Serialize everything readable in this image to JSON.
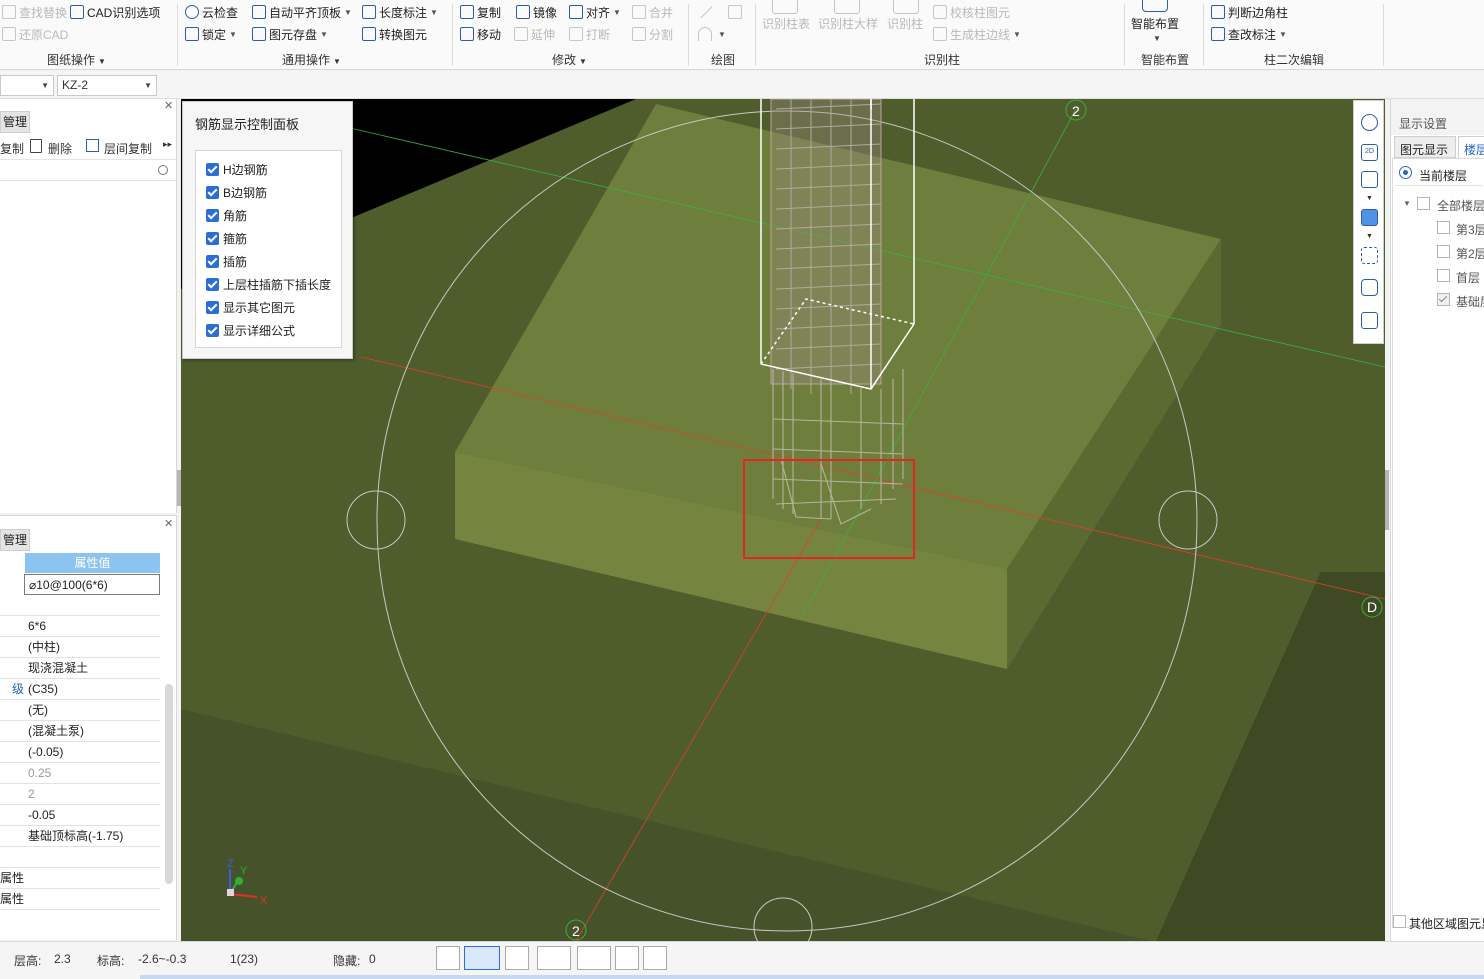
{
  "ribbon": {
    "groups": {
      "drawing_ops": "图纸操作",
      "common_ops": "通用操作",
      "modify": "修改",
      "draw": "绘图",
      "identify_column": "识别柱",
      "smart_layout": "智能布置",
      "column_secondary_edit": "柱二次编辑"
    },
    "items": {
      "find_replace": "查找替换",
      "cad_options": "CAD识别选项",
      "restore_cad": "还原CAD",
      "cloud_check": "云检查",
      "auto_flush_top": "自动平齐顶板",
      "length_dim": "长度标注",
      "lock": "锁定",
      "element_save": "图元存盘",
      "convert_element": "转换图元",
      "copy": "复制",
      "mirror": "镜像",
      "align": "对齐",
      "merge": "合并",
      "move": "移动",
      "extend": "延伸",
      "break": "打断",
      "split": "分割",
      "identify_column_table": "识别柱表",
      "identify_column_detail": "识别柱大样",
      "identify_column": "识别柱",
      "check_column": "校核柱图元",
      "gen_column_edge": "生成柱边线",
      "smart_layout": "智能布置",
      "judge_corner_column": "判断边角柱",
      "check_annotation": "查改标注"
    }
  },
  "sub_toolbar": {
    "combo_left_value": "",
    "combo_component_value": "KZ-2"
  },
  "left_top_panel": {
    "tab_label": "管理",
    "copy_label": "复制",
    "delete_label": "删除",
    "floor_copy_label": "层间复制"
  },
  "left_bottom_panel": {
    "tab_label": "管理",
    "header_value": "属性值",
    "rows": [
      {
        "key": "",
        "value": "⌀10@100(6*6)"
      },
      {
        "key": "",
        "value": ""
      },
      {
        "key": "",
        "value": "6*6"
      },
      {
        "key": "",
        "value": "(中柱)"
      },
      {
        "key": "",
        "value": "现浇混凝土"
      },
      {
        "key": "级",
        "value": "(C35)"
      },
      {
        "key": "",
        "value": "(无)"
      },
      {
        "key": "",
        "value": "(混凝土泵)"
      },
      {
        "key": "",
        "value": "(-0.05)"
      },
      {
        "key": "",
        "value": "0.25"
      },
      {
        "key": "",
        "value": "2"
      },
      {
        "key": "",
        "value": "-0.05"
      },
      {
        "key": "",
        "value": "基础顶标高(-1.75)"
      },
      {
        "key": "",
        "value": ""
      },
      {
        "key": "属性",
        "value": ""
      },
      {
        "key": "属性",
        "value": ""
      }
    ]
  },
  "rebar_panel": {
    "title": "钢筋显示控制面板",
    "options": [
      {
        "label": "H边钢筋",
        "checked": true
      },
      {
        "label": "B边钢筋",
        "checked": true
      },
      {
        "label": "角筋",
        "checked": true
      },
      {
        "label": "箍筋",
        "checked": true
      },
      {
        "label": "插筋",
        "checked": true
      },
      {
        "label": "上层柱插筋下插长度",
        "checked": true
      },
      {
        "label": "显示其它图元",
        "checked": true
      },
      {
        "label": "显示详细公式",
        "checked": true
      }
    ]
  },
  "viewport": {
    "axis_label_2_top": "2",
    "axis_label_2_bottom": "2",
    "axis_label_d": "D",
    "coord_x": "X",
    "coord_y": "Y",
    "coord_z": "Z",
    "colors": {
      "background": "#000000",
      "slab": "#6e7e3c",
      "grid_green": "#3cb043",
      "grid_red": "#e0402a",
      "highlight": "#e52520"
    }
  },
  "right_panel": {
    "title": "显示设置",
    "tab_element": "图元显示",
    "tab_floor": "楼层",
    "current_floor": "当前楼层",
    "all_floors": "全部楼层",
    "floors": [
      {
        "label": "第3层",
        "checked": false
      },
      {
        "label": "第2层",
        "checked": false
      },
      {
        "label": "首层",
        "checked": false
      },
      {
        "label": "基础层",
        "checked": true
      }
    ],
    "other_region": "其他区域图元显示"
  },
  "status_bar": {
    "floor_height_label": "层高:",
    "floor_height_value": "2.3",
    "elevation_label": "标高:",
    "elevation_value": "-2.6~-0.3",
    "count": "1(23)",
    "hidden_label": "隐藏:",
    "hidden_value": "0"
  }
}
